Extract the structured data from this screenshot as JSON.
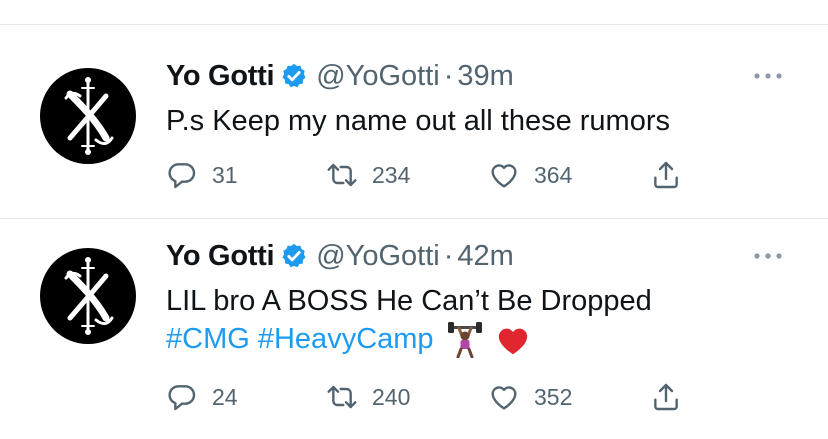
{
  "tweets": [
    {
      "name": "Yo Gotti",
      "handle": "@YoGotti",
      "separator": "·",
      "time": "39m",
      "text": "P.s Keep my name out all these rumors",
      "hashtags": [],
      "replies": "31",
      "retweets": "234",
      "likes": "364"
    },
    {
      "name": "Yo Gotti",
      "handle": "@YoGotti",
      "separator": "·",
      "time": "42m",
      "text": "LIL bro A BOSS He Can’t Be Dropped",
      "hashtags": [
        "#CMG",
        "#HeavyCamp"
      ],
      "emojis": [
        "weight-lifter-emoji",
        "red-heart-emoji"
      ],
      "replies": "24",
      "retweets": "240",
      "likes": "352"
    }
  ],
  "colors": {
    "link": "#1d9bf0",
    "verified": "#1d9bf0",
    "secondary_text": "#536471",
    "heart": "#e0262f"
  }
}
